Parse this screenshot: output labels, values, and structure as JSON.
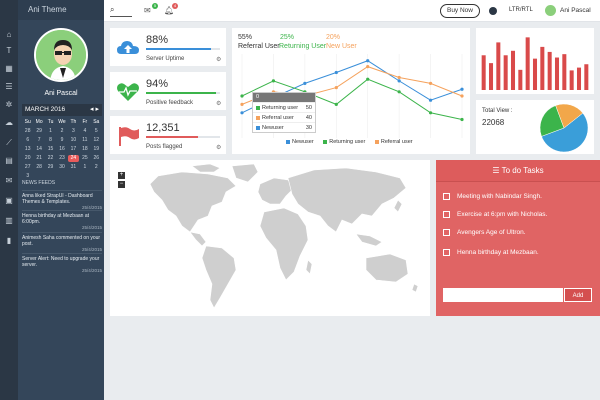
{
  "brand": "Ani Theme",
  "user": {
    "name": "Ani Pascal"
  },
  "topbar": {
    "mail_count": "5",
    "notif_count": "4",
    "buy_label": "Buy Now",
    "ltr_label": "LTR/RTL",
    "user_name": "Ani Pascal"
  },
  "calendar": {
    "month": "MARCH 2016",
    "day_headers": [
      "Su",
      "Mo",
      "Tu",
      "We",
      "Th",
      "Fr",
      "Sa"
    ],
    "days": [
      "28",
      "29",
      "1",
      "2",
      "3",
      "4",
      "5",
      "6",
      "7",
      "8",
      "9",
      "10",
      "11",
      "12",
      "13",
      "14",
      "15",
      "16",
      "17",
      "18",
      "19",
      "20",
      "21",
      "22",
      "23",
      "24",
      "25",
      "26",
      "27",
      "28",
      "29",
      "30",
      "31",
      "1",
      "2",
      "3"
    ]
  },
  "feeds": {
    "title": "NEWS FEEDS",
    "items": [
      {
        "text": "Anna liked StrapUI - Dashboard Themes & Templates.",
        "date": "25/4/2015"
      },
      {
        "text": "Henna birthday at Mezbaan at 6:00pm.",
        "date": "25/4/2015"
      },
      {
        "text": "Animesh Saha commented on your post.",
        "date": "25/4/2015"
      },
      {
        "text": "Server Alert: Need to upgrade your server.",
        "date": "25/4/2015"
      }
    ]
  },
  "stats": [
    {
      "value": "88%",
      "label": "Server Uptime",
      "progress": 0.88,
      "color": "#3a8fd9",
      "icon": "cloud-upload-icon"
    },
    {
      "value": "94%",
      "label": "Positive feedback",
      "progress": 0.94,
      "color": "#3cb44b",
      "icon": "heartbeat-icon"
    },
    {
      "value": "12,351",
      "label": "Posts flagged",
      "progress": 0.7,
      "color": "#e05b5b",
      "icon": "flag-icon"
    }
  ],
  "line_chart": {
    "percents": [
      "55%",
      "25%",
      "20%"
    ],
    "series_labels": [
      "Referral User",
      "Returning User",
      "New User"
    ],
    "tooltip_header": "0",
    "tooltip": [
      {
        "name": "Returning user",
        "value": "50",
        "color": "#3cb44b"
      },
      {
        "name": "Referral user",
        "value": "40",
        "color": "#f5a25d"
      },
      {
        "name": "Newuser",
        "value": "30",
        "color": "#3a8fd9"
      }
    ],
    "legend": [
      "Newuser",
      "Returning user",
      "Referral user"
    ],
    "colors": {
      "new": "#3a8fd9",
      "returning": "#3cb44b",
      "referral": "#f5a25d"
    }
  },
  "chart_data": [
    {
      "type": "line",
      "title": "",
      "x": [
        0,
        1,
        2,
        3,
        4,
        5,
        6,
        7
      ],
      "series": [
        {
          "name": "Newuser",
          "values": [
            30,
            48,
            65,
            78,
            92,
            68,
            45,
            58
          ]
        },
        {
          "name": "Returning user",
          "values": [
            50,
            68,
            55,
            40,
            70,
            55,
            30,
            22
          ]
        },
        {
          "name": "Referral user",
          "values": [
            40,
            55,
            50,
            60,
            85,
            72,
            65,
            50
          ]
        }
      ],
      "ylim": [
        0,
        100
      ]
    },
    {
      "type": "bar",
      "values": [
        62,
        48,
        85,
        62,
        70,
        36,
        94,
        56,
        77,
        68,
        58,
        64,
        35,
        40,
        46
      ],
      "ylim": [
        0,
        100
      ],
      "color": "#d94a4a"
    },
    {
      "type": "pie",
      "values": [
        55,
        25,
        20
      ],
      "colors": [
        "#3a9ed9",
        "#3cb44b",
        "#f2a74a"
      ]
    }
  ],
  "total_view": {
    "label": "Total View :",
    "value": "22068"
  },
  "todo": {
    "title": "To do Tasks",
    "items": [
      "Meeting with Nabindar Singh.",
      "Exercise at 6:pm with Nicholas.",
      "Avengers Age of Ultron.",
      "Henna birthday at Mezbaan."
    ],
    "add_label": "Add"
  }
}
